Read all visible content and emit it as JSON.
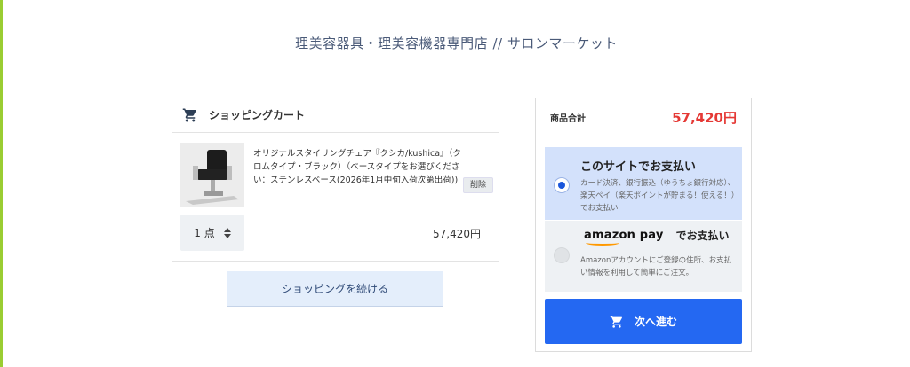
{
  "header": {
    "shop_title": "理美容器具・理美容機器専門店 // サロンマーケット"
  },
  "cart": {
    "title": "ショッピングカート",
    "item": {
      "name": "オリジナルスタイリングチェア『クシカ/kushica』（クロムタイプ・ブラック）（ベースタイプをお選びください：ステンレスベース(2026年1月中旬入荷次第出荷))",
      "delete_label": "削除",
      "quantity_label": "1 点",
      "price": "57,420円"
    },
    "continue_label": "ショッピングを続ける"
  },
  "summary": {
    "total_label": "商品合計",
    "total_value": "57,420円",
    "payment_site": {
      "title": "このサイトでお支払い",
      "description": "カード決済、銀行振込（ゆうちょ銀行対応）、楽天ペイ（楽天ポイントが貯まる！使える！）でお支払い",
      "selected": true
    },
    "payment_amazon": {
      "logo_text": "amazon pay",
      "title_suffix": "でお支払い",
      "description": "Amazonアカウントにご登録の住所、お支払い情報を利用して簡単にご注文。",
      "selected": false
    },
    "next_label": "次へ進む"
  },
  "colors": {
    "accent_blue": "#2468f2",
    "total_red": "#e53935",
    "amazon_orange": "#ff9900"
  },
  "icons": [
    "cart-icon",
    "radio-selected-icon",
    "radio-unselected-icon",
    "updown-icon"
  ]
}
